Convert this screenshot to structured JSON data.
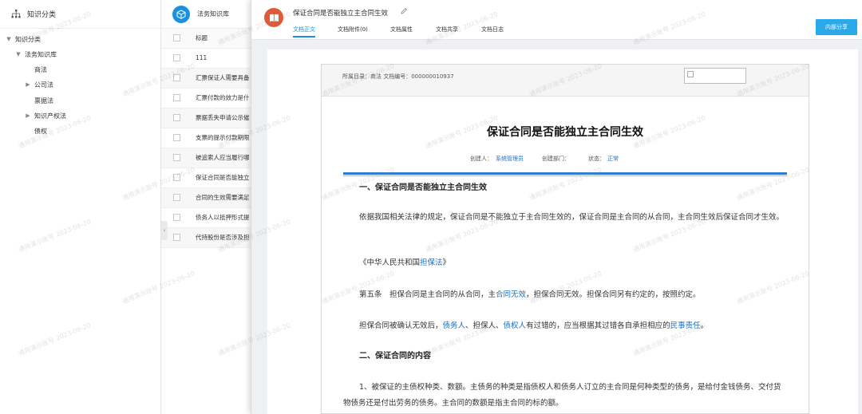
{
  "tree_panel": {
    "title": "知识分类",
    "nodes": [
      {
        "label": "知识分类",
        "caret": "▼"
      },
      {
        "label": "法务知识库",
        "caret": "▼"
      },
      {
        "label": "商法",
        "caret": ""
      },
      {
        "label": "公司法",
        "caret": "▶"
      },
      {
        "label": "票据法",
        "caret": ""
      },
      {
        "label": "知识产权法",
        "caret": "▶"
      },
      {
        "label": "债权",
        "caret": ""
      }
    ]
  },
  "list_panel": {
    "title": "法务知识库",
    "column_header": "标题",
    "rows": [
      "111",
      "汇票保证人需要具备",
      "汇票付款的效力是什",
      "票据丢失申请公示催",
      "支票的提示付款期限",
      "被追索人应当履行哪",
      "保证合同是否能独立",
      "合同的生效需要满足",
      "债务人以抵押形式提",
      "代持股份是否涉及担"
    ],
    "collapse_glyph": "‹"
  },
  "doc_panel": {
    "title": "保证合同是否能独立主合同生效",
    "tabs": [
      "文档正文",
      "文档附件(0)",
      "文档属性",
      "文档共享",
      "文档日志"
    ],
    "active_tab": 0,
    "share_button": "内部分享",
    "paper": {
      "meta": "所属目录：商法    文档编号：000000010937",
      "article_title": "保证合同是否能独立主合同生效",
      "creator_label": "创建人：",
      "creator": "系统管理员",
      "dept_label": "创建部门：",
      "status_label": "状态：",
      "status": "正常",
      "section1_heading": "一、保证合同是否能独立主合同生效",
      "para1": "依据我国相关法律的规定，保证合同是不能独立于主合同生效的，保证合同是主合同的从合同，主合同生效后保证合同才生效。",
      "para2_pre": "《中华人民共和国",
      "para2_link": "担保法",
      "para2_post": "》",
      "para3_pre": "第五条　担保合同是主合同的从合同，主",
      "para3_link": "合同无效",
      "para3_post": "，担保合同无效。担保合同另有约定的，按照约定。",
      "para4_a": "担保合同被确认无效后，",
      "para4_link1": "债务人",
      "para4_b": "、担保人、",
      "para4_link2": "债权人",
      "para4_c": "有过错的，应当根据其过错各自承担相应的",
      "para4_link3": "民事责任",
      "para4_d": "。",
      "section2_heading": "二、保证合同的内容",
      "para5": "1、被保证的主债权种类、数额。主债务的种类是指债权人和债务人订立的主合同是何种类型的债务，是给付金钱债务、交付货物债务还是付出劳务的债务。主合同的数额是指主合同的标的额。"
    }
  },
  "watermark": "通用演示账号 2023-06-20",
  "colors": {
    "accent_blue": "#1a8fdd",
    "share_button": "#29a8ea",
    "link_blue": "#1a6fc8",
    "book_icon": "#e05a3a",
    "cube_icon": "#1a90e0"
  }
}
